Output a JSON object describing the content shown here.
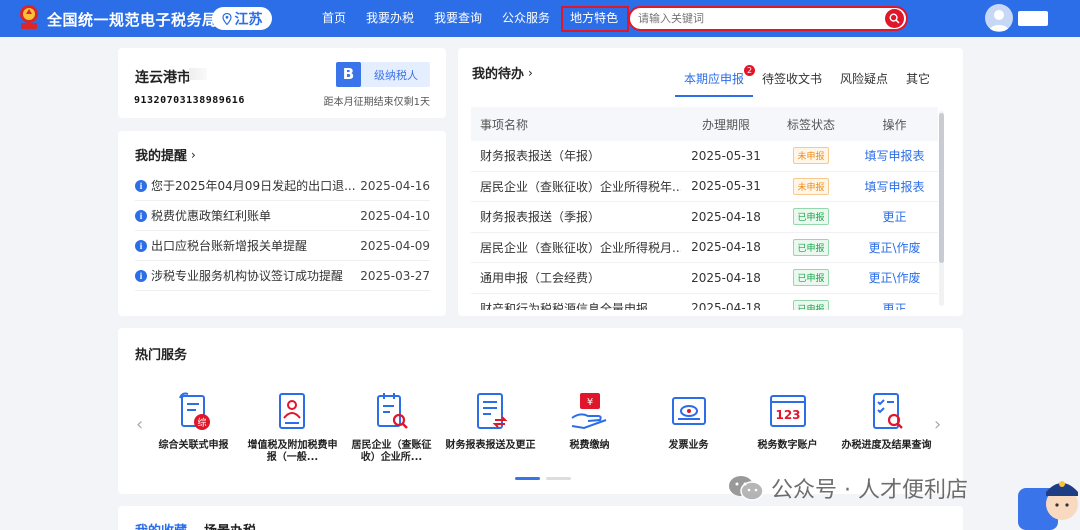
{
  "header": {
    "site_title": "全国统一规范电子税务局",
    "region": "江苏",
    "nav": [
      "首页",
      "我要办税",
      "我要查询",
      "公众服务",
      "地方特色"
    ],
    "search_placeholder": "请输入关键词"
  },
  "taxpayer": {
    "city": "连云港市",
    "id": "91320703138989616",
    "level_letter": "B",
    "level_label": "级纳税人",
    "deadline_note": "距本月征期结束仅剩1天"
  },
  "reminders": {
    "title": "我的提醒",
    "items": [
      {
        "text": "您于2025年04月09日发起的出口退...",
        "date": "2025-04-16"
      },
      {
        "text": "税费优惠政策红利账单",
        "date": "2025-04-10"
      },
      {
        "text": "出口应税台账新增报关单提醒",
        "date": "2025-04-09"
      },
      {
        "text": "涉税专业服务机构协议签订成功提醒",
        "date": "2025-03-27"
      }
    ]
  },
  "todo": {
    "title": "我的待办",
    "tabs": [
      "本期应申报",
      "待签收文书",
      "风险疑点",
      "其它"
    ],
    "badge": "2",
    "columns": [
      "事项名称",
      "办理期限",
      "标签状态",
      "操作"
    ],
    "rows": [
      {
        "name": "财务报表报送（年报）",
        "date": "2025-05-31",
        "status": "未申报",
        "op": "填写申报表",
        "done": false
      },
      {
        "name": "居民企业（查账征收）企业所得税年...",
        "date": "2025-05-31",
        "status": "未申报",
        "op": "填写申报表",
        "done": false
      },
      {
        "name": "财务报表报送（季报）",
        "date": "2025-04-18",
        "status": "已申报",
        "op": "更正",
        "done": true
      },
      {
        "name": "居民企业（查账征收）企业所得税月...",
        "date": "2025-04-18",
        "status": "已申报",
        "op": "更正\\作废",
        "done": true
      },
      {
        "name": "通用申报（工会经费）",
        "date": "2025-04-18",
        "status": "已申报",
        "op": "更正\\作废",
        "done": true
      },
      {
        "name": "财产和行为税税源信息全量申报",
        "date": "2025-04-18",
        "status": "已申报",
        "op": "更正",
        "done": true
      }
    ]
  },
  "hot_services": {
    "title": "热门服务",
    "items": [
      {
        "label": "综合关联式申报",
        "icon": "composite-report-icon"
      },
      {
        "label": "增值税及附加税费申报（一般...",
        "icon": "vat-report-icon"
      },
      {
        "label": "居民企业（查账征收）企业所...",
        "icon": "income-tax-icon"
      },
      {
        "label": "财务报表报送及更正",
        "icon": "financial-statement-icon"
      },
      {
        "label": "税费缴纳",
        "icon": "tax-payment-icon"
      },
      {
        "label": "发票业务",
        "icon": "invoice-icon"
      },
      {
        "label": "税务数字账户",
        "icon": "digital-account-icon"
      },
      {
        "label": "办税进度及结果查询",
        "icon": "progress-query-icon"
      }
    ]
  },
  "bottom_tabs": [
    "我的收藏",
    "场景办税"
  ],
  "watermark": "公众号 · 人才便利店",
  "colors": {
    "primary": "#2b6ee8",
    "highlight": "#e0162b",
    "pending": "#f08c1b",
    "done": "#18a64a"
  }
}
